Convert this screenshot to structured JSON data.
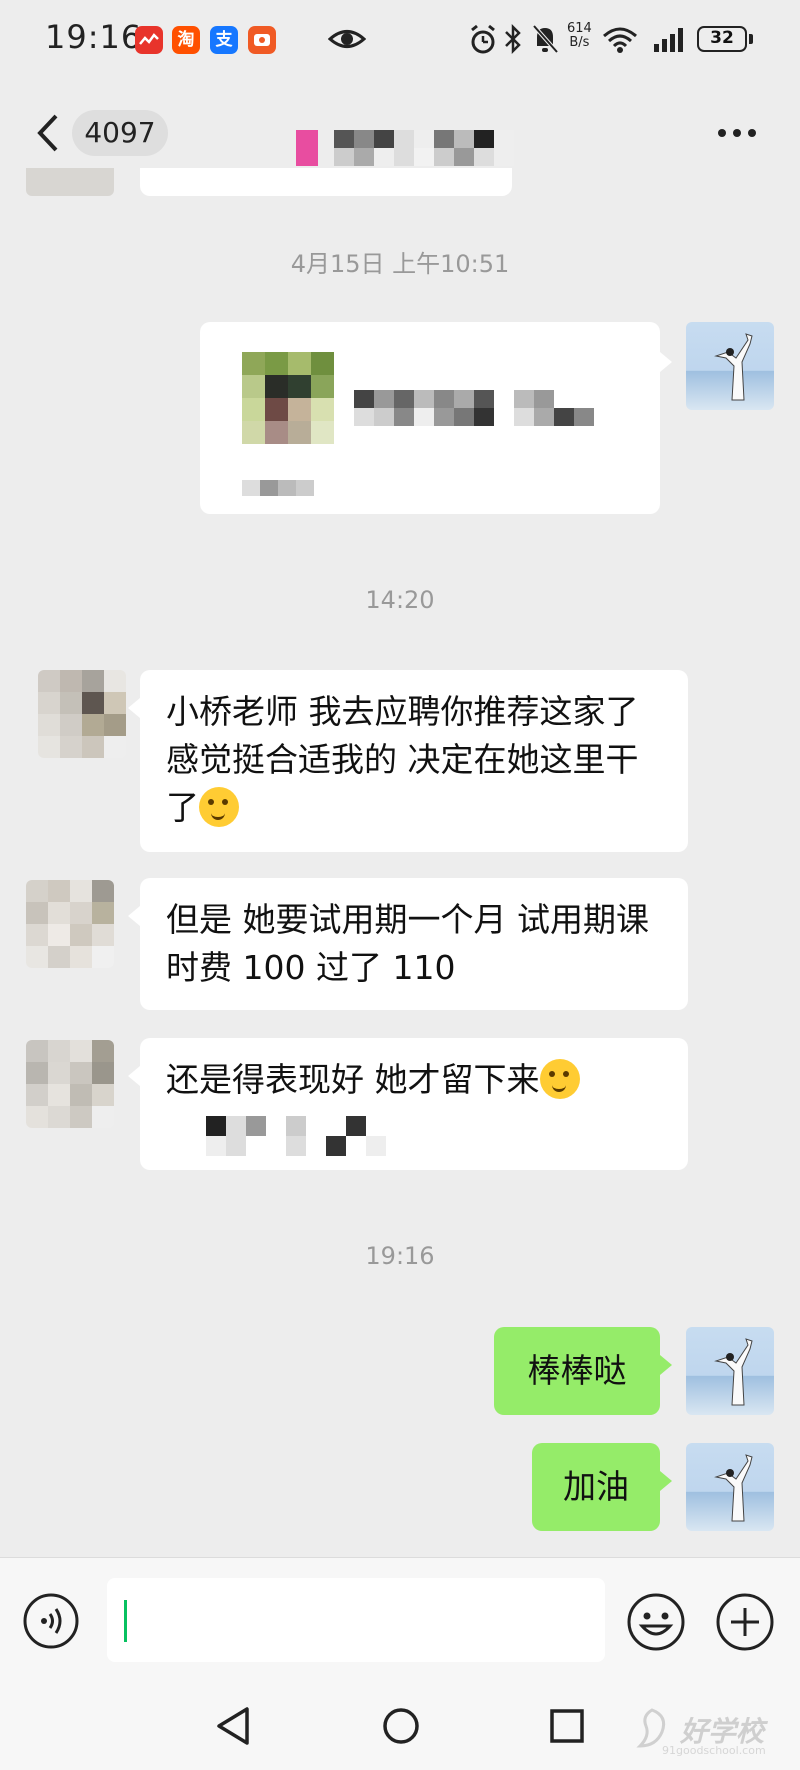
{
  "status_bar": {
    "time": "19:16",
    "app_icons": [
      {
        "name": "red-app-icon",
        "label": "",
        "color": "#e8342b"
      },
      {
        "name": "taobao-icon",
        "label": "淘",
        "color": "#ff5000"
      },
      {
        "name": "alipay-icon",
        "label": "支",
        "color": "#1677ff"
      },
      {
        "name": "orange-app-icon",
        "label": "",
        "color": "#f05a24"
      }
    ],
    "net_speed_value": "614",
    "net_speed_unit": "B/s",
    "battery": "32"
  },
  "header": {
    "unread_count": "4097"
  },
  "messages": {
    "timestamp_1": "4月15日 上午10:51",
    "timestamp_2": "14:20",
    "incoming_1": "小桥老师  我去应聘你推荐这家了  感觉挺合适我的   决定在她这里干了",
    "incoming_2": "但是  她要试用期一个月   试用期课时费 100 过了 110",
    "incoming_3": "还是得表现好  她才留下来",
    "timestamp_3": "19:16",
    "outgoing_1": "棒棒哒",
    "outgoing_2": "加油"
  },
  "input": {
    "value": ""
  },
  "watermark": {
    "text": "好学校",
    "sub": "91goodschool.com"
  },
  "colors": {
    "background": "#ededed",
    "outgoing_bubble": "#95ec69",
    "incoming_bubble": "#ffffff",
    "accent": "#07c160"
  }
}
